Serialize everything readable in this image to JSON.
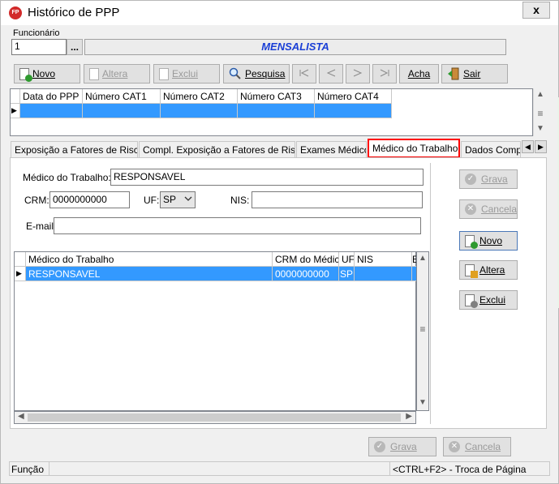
{
  "window": {
    "title": "Histórico de PPP",
    "app_icon_text": "FP",
    "close_label": "x"
  },
  "funcionario": {
    "label": "Funcionário",
    "value": "1",
    "lookup_label": "...",
    "name": "MENSALISTA"
  },
  "toolbar": {
    "novo": "Novo",
    "altera": "Altera",
    "exclui": "Exclui",
    "pesquisa": "Pesquisa",
    "acha": "Acha",
    "sair": "Sair"
  },
  "top_grid": {
    "columns": [
      "Data do PPP",
      "Número CAT1",
      "Número CAT2",
      "Número CAT3",
      "Número CAT4"
    ]
  },
  "tabs": [
    "Exposição a Fatores de Riscos",
    "Compl. Exposição a Fatores de Riscos",
    "Exames Médicos",
    "Médico do Trabalho",
    "Dados Complem"
  ],
  "form": {
    "medico_label": "Médico do Trabalho:",
    "medico_value": "RESPONSAVEL",
    "crm_label": "CRM:",
    "crm_value": "0000000000",
    "uf_label": "UF:",
    "uf_value": "SP",
    "nis_label": "NIS:",
    "nis_value": "",
    "email_label": "E-mail:",
    "email_value": ""
  },
  "detail_grid": {
    "columns": [
      "Médico do Trabalho",
      "CRM do Médico",
      "UF",
      "NIS",
      "E"
    ],
    "rows": [
      [
        "RESPONSAVEL",
        "0000000000",
        "SP",
        "",
        ""
      ]
    ]
  },
  "side_buttons": {
    "grava": "Grava",
    "cancela": "Cancela",
    "novo": "Novo",
    "altera": "Altera",
    "exclui": "Exclui"
  },
  "bottom_buttons": {
    "grava": "Grava",
    "cancela": "Cancela"
  },
  "status": {
    "left": "Função",
    "right": "<CTRL+F2> - Troca de Página"
  },
  "colors": {
    "selection": "#3399ff",
    "title_blue": "#1a3fd6",
    "highlight_border": "#ff0000"
  }
}
